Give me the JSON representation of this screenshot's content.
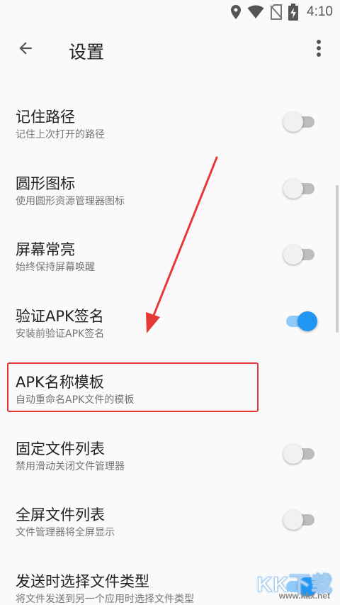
{
  "status_bar": {
    "time": "4:10",
    "icons": [
      "location-icon",
      "wifi-icon",
      "no-sim-icon",
      "battery-charging-icon"
    ]
  },
  "app_bar": {
    "back_icon": "arrow-back-icon",
    "title": "设置",
    "more_icon": "more-vert-icon"
  },
  "settings": [
    {
      "title": "记住路径",
      "subtitle": "记住上次打开的路径",
      "toggle": false
    },
    {
      "title": "圆形图标",
      "subtitle": "使用圆形资源管理器图标",
      "toggle": false
    },
    {
      "title": "屏幕常亮",
      "subtitle": "始终保持屏幕唤醒",
      "toggle": false
    },
    {
      "title": "验证APK签名",
      "subtitle": "安装前验证APK签名",
      "toggle": true
    },
    {
      "title": "APK名称模板",
      "subtitle": "自动重命名APK文件的模板"
    },
    {
      "title": "固定文件列表",
      "subtitle": "禁用滑动关闭文件管理器",
      "toggle": false
    },
    {
      "title": "全屏文件列表",
      "subtitle": "文件管理器将全屏显示",
      "toggle": false
    },
    {
      "title": "发送时选择文件类型",
      "subtitle": "将文件发送到另一个应用时选择文件类型",
      "toggle": true
    }
  ],
  "annotation": {
    "highlight_color": "#e53935",
    "arrow_color": "#e53935"
  },
  "watermark": {
    "text": "KK下载",
    "url": "www.kkx.net"
  },
  "colors": {
    "accent": "#2196f3",
    "background": "#fafafa"
  }
}
